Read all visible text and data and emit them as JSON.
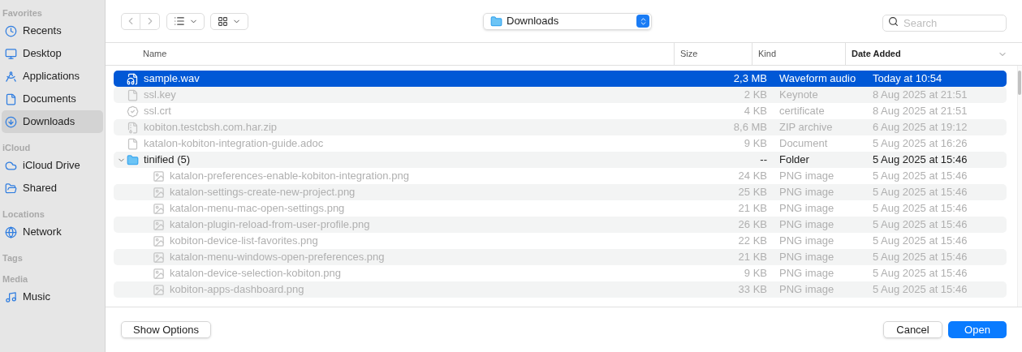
{
  "sidebar": [
    {
      "title": "Favorites",
      "items": [
        {
          "label": "Recents",
          "selected": false
        },
        {
          "label": "Desktop",
          "selected": false
        },
        {
          "label": "Applications",
          "selected": false
        },
        {
          "label": "Documents",
          "selected": false
        },
        {
          "label": "Downloads",
          "selected": true
        }
      ]
    },
    {
      "title": "iCloud",
      "items": [
        {
          "label": "iCloud Drive",
          "selected": false
        },
        {
          "label": "Shared",
          "selected": false
        }
      ]
    },
    {
      "title": "Locations",
      "items": [
        {
          "label": "Network",
          "selected": false
        }
      ]
    },
    {
      "title": "Tags"
    },
    {
      "title": "Media",
      "items": [
        {
          "label": "Music",
          "selected": false
        }
      ]
    }
  ],
  "location": "Downloads",
  "search": {
    "placeholder": "Search"
  },
  "columns": [
    {
      "label": "Name",
      "sorted": false
    },
    {
      "label": "Size",
      "sorted": false
    },
    {
      "label": "Kind",
      "sorted": false
    },
    {
      "label": "Date Added",
      "sorted": true
    }
  ],
  "rows": [
    {
      "kind": "audio",
      "name": "sample.wav",
      "size": "2,3 MB",
      "type": "Waveform audio",
      "date": "Today at 10:54",
      "selected": true,
      "disabled": false
    },
    {
      "kind": "doc",
      "name": "ssl.key",
      "size": "2 KB",
      "type": "Keynote",
      "date": "8 Aug 2025 at 21:51",
      "selected": false,
      "disabled": true
    },
    {
      "kind": "cert",
      "name": "ssl.crt",
      "size": "4 KB",
      "type": "certificate",
      "date": "8 Aug 2025 at 21:51",
      "selected": false,
      "disabled": true
    },
    {
      "kind": "zip",
      "name": "kobiton.testcbsh.com.har.zip",
      "size": "8,6 MB",
      "type": "ZIP archive",
      "date": "6 Aug 2025 at 19:12",
      "selected": false,
      "disabled": true
    },
    {
      "kind": "doc",
      "name": "katalon-kobiton-integration-guide.adoc",
      "size": "9 KB",
      "type": "Document",
      "date": "5 Aug 2025 at 16:26",
      "selected": false,
      "disabled": true
    },
    {
      "kind": "folder",
      "name": "tinified (5)",
      "size": "--",
      "type": "Folder",
      "date": "5 Aug 2025 at 15:46",
      "selected": false,
      "disabled": false,
      "expanded": true,
      "children": [
        {
          "kind": "image",
          "name": "katalon-preferences-enable-kobiton-integration.png",
          "size": "24 KB",
          "type": "PNG image",
          "date": "5 Aug 2025 at 15:46",
          "selected": false,
          "disabled": true
        },
        {
          "kind": "image",
          "name": "katalon-settings-create-new-project.png",
          "size": "25 KB",
          "type": "PNG image",
          "date": "5 Aug 2025 at 15:46",
          "selected": false,
          "disabled": true
        },
        {
          "kind": "image",
          "name": "katalon-menu-mac-open-settings.png",
          "size": "21 KB",
          "type": "PNG image",
          "date": "5 Aug 2025 at 15:46",
          "selected": false,
          "disabled": true
        },
        {
          "kind": "image",
          "name": "katalon-plugin-reload-from-user-profile.png",
          "size": "26 KB",
          "type": "PNG image",
          "date": "5 Aug 2025 at 15:46",
          "selected": false,
          "disabled": true
        },
        {
          "kind": "image",
          "name": "kobiton-device-list-favorites.png",
          "size": "22 KB",
          "type": "PNG image",
          "date": "5 Aug 2025 at 15:46",
          "selected": false,
          "disabled": true
        },
        {
          "kind": "image",
          "name": "katalon-menu-windows-open-preferences.png",
          "size": "21 KB",
          "type": "PNG image",
          "date": "5 Aug 2025 at 15:46",
          "selected": false,
          "disabled": true
        },
        {
          "kind": "image",
          "name": "katalon-device-selection-kobiton.png",
          "size": "9 KB",
          "type": "PNG image",
          "date": "5 Aug 2025 at 15:46",
          "selected": false,
          "disabled": true
        },
        {
          "kind": "image",
          "name": "kobiton-apps-dashboard.png",
          "size": "33 KB",
          "type": "PNG image",
          "date": "5 Aug 2025 at 15:46",
          "selected": false,
          "disabled": true
        }
      ]
    }
  ],
  "buttons": {
    "options": "Show Options",
    "cancel": "Cancel",
    "open": "Open"
  }
}
